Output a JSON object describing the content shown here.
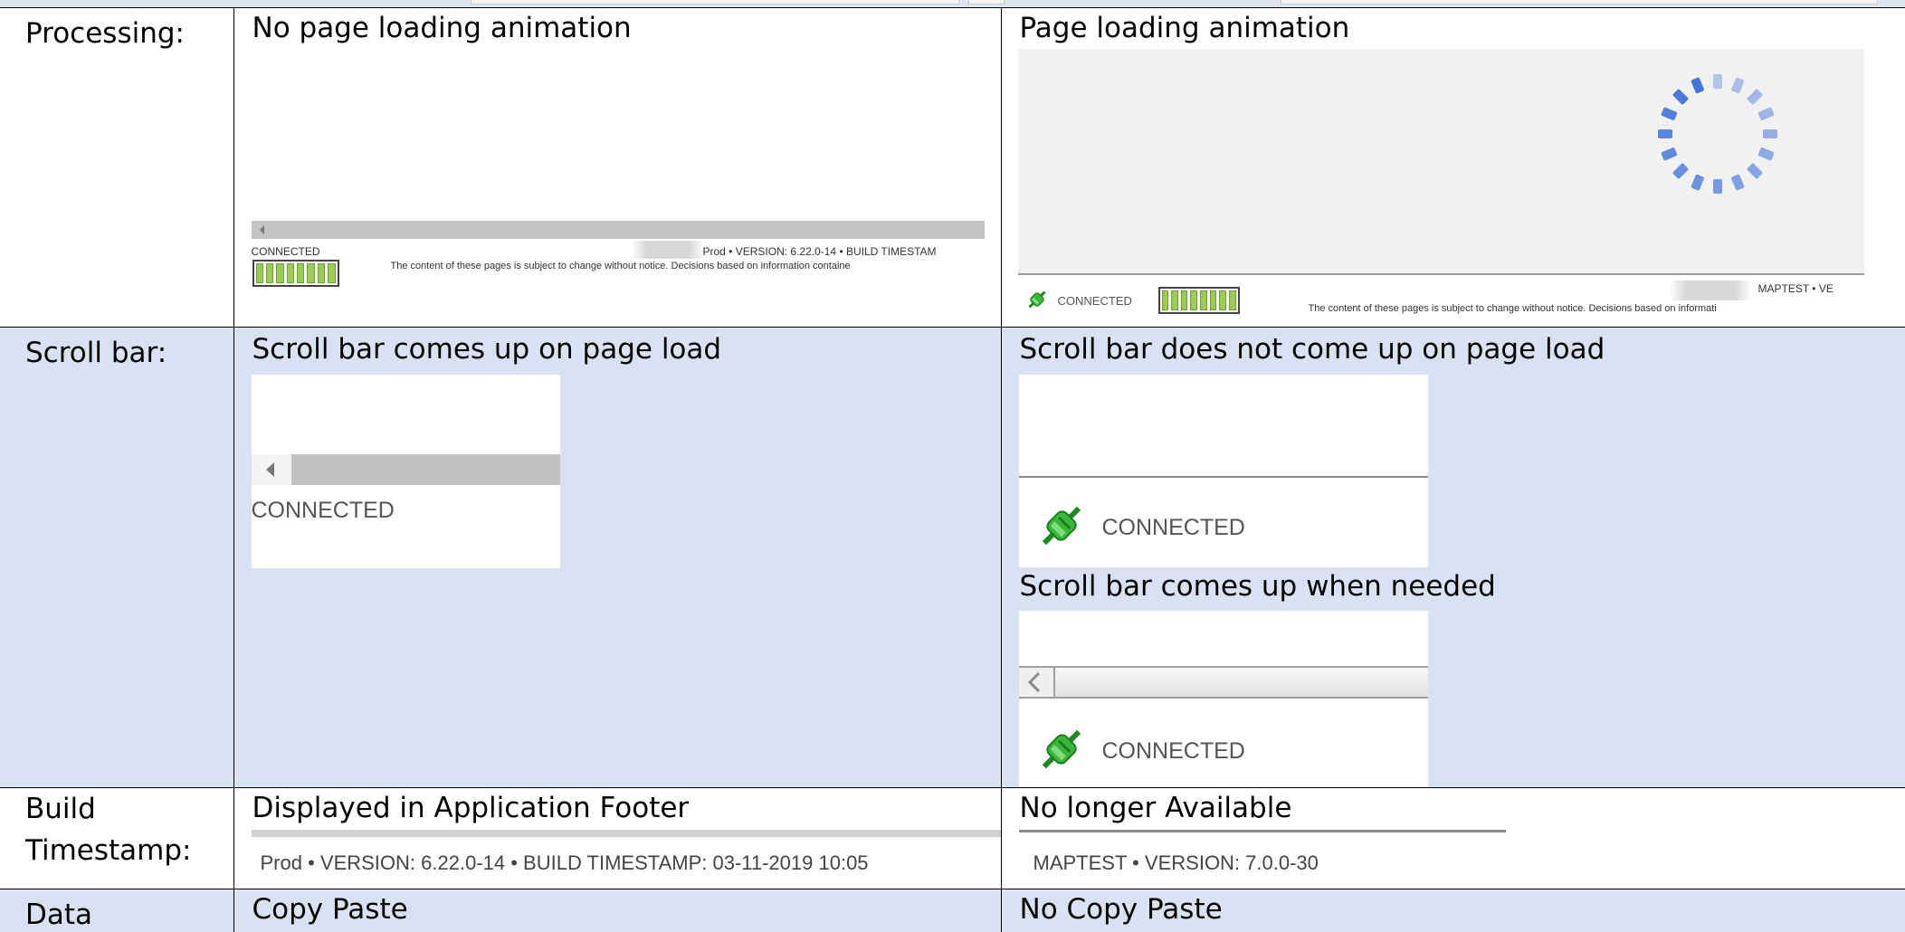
{
  "rows": {
    "processing": {
      "label": "Processing:",
      "left": {
        "caption": "No page loading animation",
        "status": "CONNECTED",
        "footer_version": "Prod  •  VERSION: 6.22.0-14  •  BUILD TIMESTAM",
        "notice": "The content of these pages is subject to change without notice. Decisions based on information containe"
      },
      "right": {
        "caption": "Page loading animation",
        "status": "CONNECTED",
        "footer_version": "MAPTEST  •  VE",
        "notice": "The content of these pages is subject to change without notice. Decisions based on informati"
      }
    },
    "scrollbar": {
      "label": "Scroll bar:",
      "left": {
        "caption": "Scroll bar comes up on page load",
        "status": "CONNECTED"
      },
      "right": {
        "caption": "Scroll bar does not come up on page load",
        "status": "CONNECTED",
        "caption2": "Scroll bar comes up when needed",
        "status2": "CONNECTED"
      }
    },
    "build": {
      "label_line1": "Build",
      "label_line2": "Timestamp:",
      "left": {
        "caption": "Displayed in Application Footer",
        "footer": "Prod  •  VERSION: 6.22.0-14  •  BUILD TIMESTAMP: 03-11-2019 10:05"
      },
      "right": {
        "caption": "No longer Available",
        "footer": "MAPTEST  •  VERSION: 7.0.0-30"
      }
    },
    "data": {
      "label": "Data",
      "left": {
        "caption": "Copy Paste"
      },
      "right": {
        "caption": "No Copy Paste"
      }
    }
  },
  "colors": {
    "row_shade": "#d9e2f3",
    "meter_fill": "#9bcb54",
    "plug_green": "#2ea52e",
    "spinner_blue": "#3d6fd9"
  },
  "icons": [
    "plug-connected-icon",
    "loading-spinner-icon",
    "scroll-left-arrow-icon",
    "chevron-left-icon"
  ]
}
